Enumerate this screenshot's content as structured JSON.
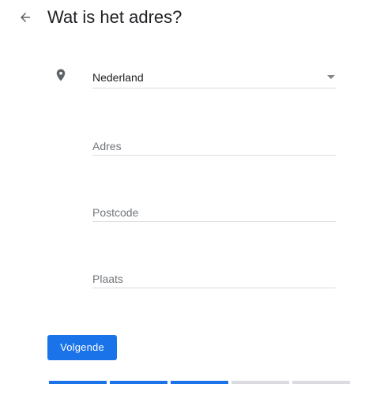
{
  "header": {
    "title": "Wat is het adres?",
    "back_icon": "arrow-left-icon"
  },
  "form": {
    "location_icon": "location-pin-icon",
    "country": {
      "value": "Nederland",
      "dropdown_icon": "triangle-down-icon"
    },
    "address": {
      "placeholder": "Adres"
    },
    "postcode": {
      "placeholder": "Postcode"
    },
    "city": {
      "placeholder": "Plaats"
    }
  },
  "actions": {
    "next_label": "Volgende"
  },
  "progress": {
    "total_steps": 5,
    "completed_steps": 3
  },
  "colors": {
    "accent": "#1a73e8",
    "inactive": "#dadce0",
    "text": "#202124",
    "placeholder": "#70757a"
  }
}
